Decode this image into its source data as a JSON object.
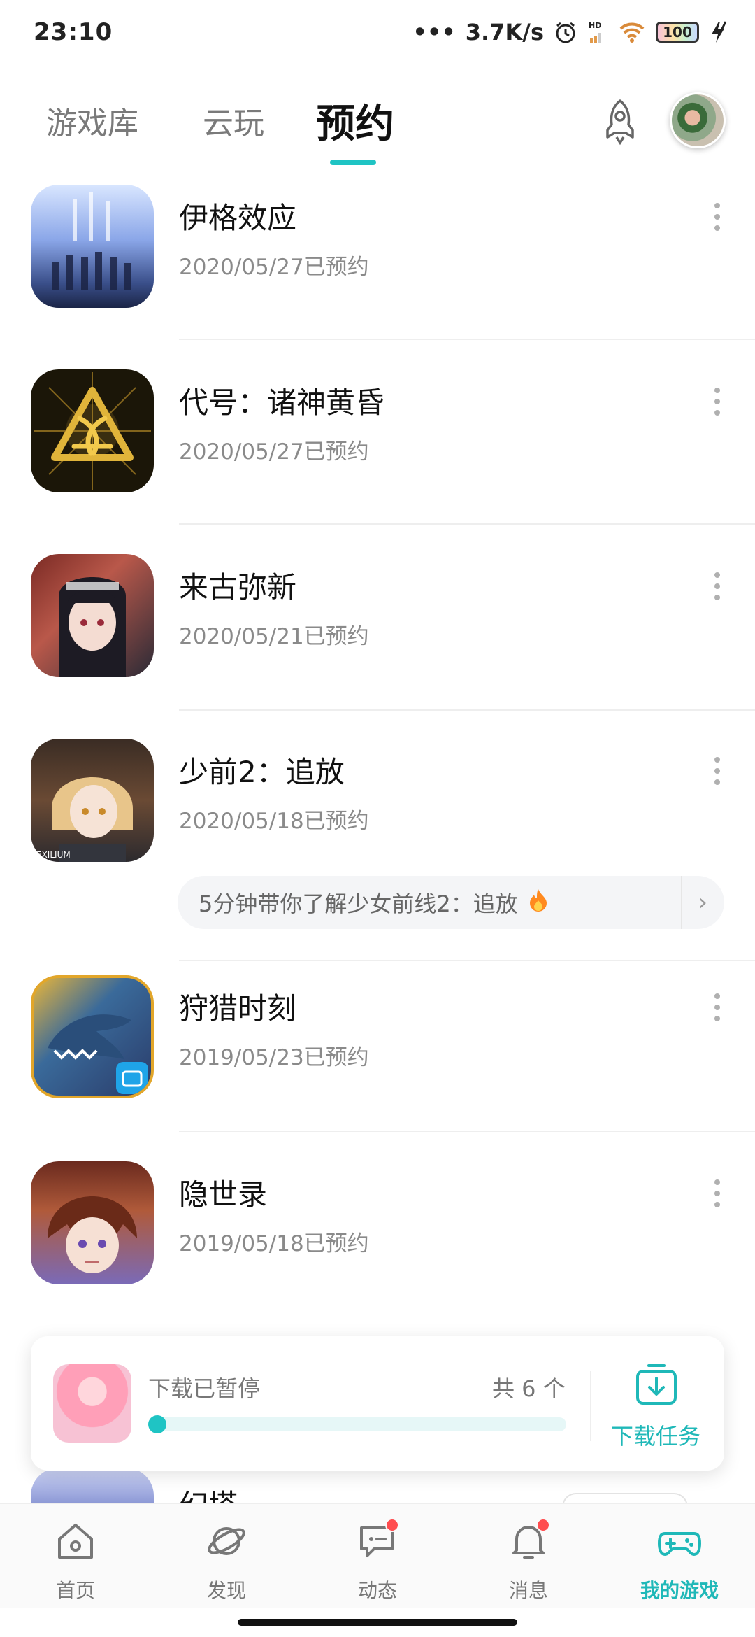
{
  "status_bar": {
    "time": "23:10",
    "net_speed": "3.7K/s",
    "battery": "100"
  },
  "top_tabs": [
    {
      "label": "游戏库",
      "active": false
    },
    {
      "label": "云玩",
      "active": false
    },
    {
      "label": "预约",
      "active": true
    }
  ],
  "accent_color": "#1fc4c4",
  "games": [
    {
      "name": "伊格效应",
      "date": "2020/05/27已预约",
      "icon": "ego-effect-icon"
    },
    {
      "name": "代号：诸神黄昏",
      "date": "2020/05/27已预约",
      "icon": "ragnarok-icon"
    },
    {
      "name": "来古弥新",
      "date": "2020/05/21已预约",
      "icon": "laigu-mixin-icon"
    },
    {
      "name": "少前2：追放",
      "date": "2020/05/18已预约",
      "icon": "gf2-exilium-icon",
      "promo": "5分钟带你了解少女前线2：追放"
    },
    {
      "name": "狩猎时刻",
      "date": "2019/05/23已预约",
      "icon": "hunting-moment-icon"
    },
    {
      "name": "隐世录",
      "date": "2019/05/18已预约",
      "icon": "yinshilu-icon"
    }
  ],
  "peek_game": {
    "name": "幻塔"
  },
  "download": {
    "status": "下载已暂停",
    "count": "共 6 个",
    "progress": 0.02,
    "task_label": "下载任务"
  },
  "bottom_nav": [
    {
      "label": "首页",
      "icon": "home-icon",
      "badge": false,
      "active": false
    },
    {
      "label": "发现",
      "icon": "planet-icon",
      "badge": false,
      "active": false
    },
    {
      "label": "动态",
      "icon": "message-square-icon",
      "badge": true,
      "active": false
    },
    {
      "label": "消息",
      "icon": "bell-icon",
      "badge": true,
      "active": false
    },
    {
      "label": "我的游戏",
      "icon": "gamepad-icon",
      "badge": false,
      "active": true
    }
  ]
}
